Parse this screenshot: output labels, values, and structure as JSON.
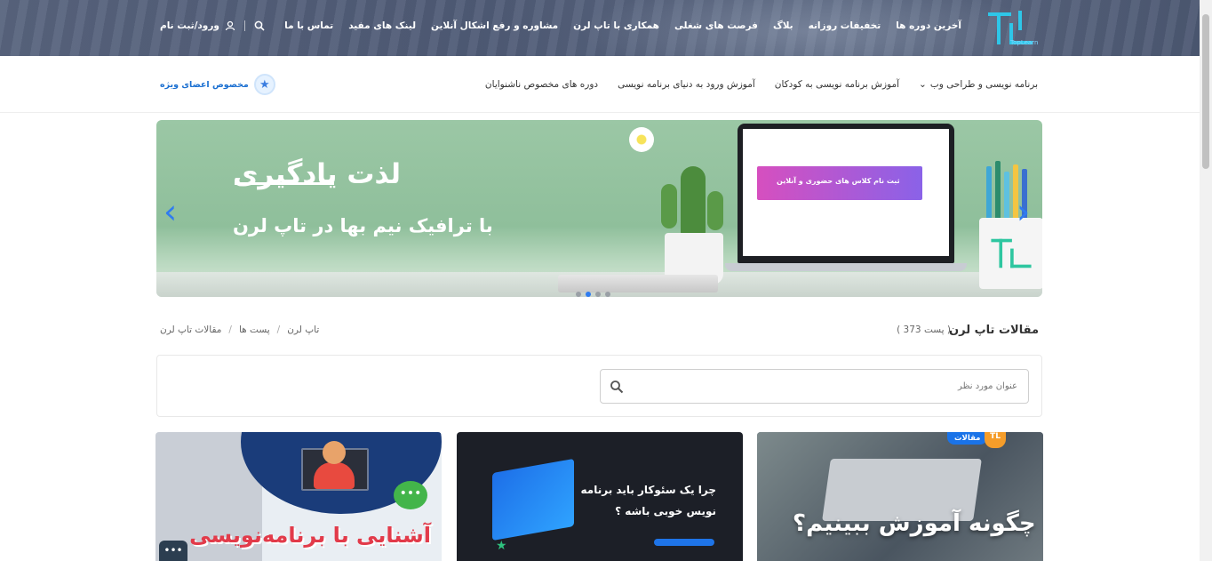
{
  "header": {
    "logo_alt": "TopLearn",
    "logo_sub": "TopLearn",
    "nav_items": [
      "آخرین دوره ها",
      "تخفیفات روزانه",
      "بلاگ",
      "فرصت های شغلی",
      "همکاری با تاپ لرن",
      "مشاوره و رفع اشکال آنلاین",
      "لینک های مفید",
      "تماس با ما"
    ],
    "login_label": "ورود/ثبت نام",
    "icons": {
      "search": "search-icon",
      "user": "user-icon"
    }
  },
  "subnav": {
    "items": [
      "برنامه نویسی و طراحی وب",
      "آموزش برنامه نویسی به کودکان",
      "آموزش ورود به دنیای برنامه نویسی",
      "دوره های مخصوص ناشنوایان"
    ],
    "vip_label": "مخصوص اعضای ویژه"
  },
  "slider": {
    "title": "لذت یادگیری",
    "subtitle": "با ترافیک نیم بها در تاپ لرن",
    "laptop_banner": "ثبت نام کلاس های حضوری و آنلاین",
    "cup_logo": "TopLearn",
    "active_dot": 2,
    "dot_count": 4
  },
  "page": {
    "title": "مقالات تاپ لرن",
    "post_count": "( 373 پست )",
    "breadcrumb": [
      "تاپ لرن",
      "پست ها",
      "مقالات تاپ لرن"
    ]
  },
  "search": {
    "placeholder": "عنوان مورد نظر"
  },
  "cards": [
    {
      "title": "آشنایی با برنامه‌نویسی"
    },
    {
      "line1": "چرا یک سئوکار باید برنامه",
      "line2": "نویس خوبی باشه ؟"
    },
    {
      "title": "چگونه آموزش ببینیم؟",
      "tag": "مقالات"
    }
  ],
  "colors": {
    "accent": "#1a73e8",
    "header_bg": "#56627c",
    "vip_text": "#1a6fd1"
  }
}
